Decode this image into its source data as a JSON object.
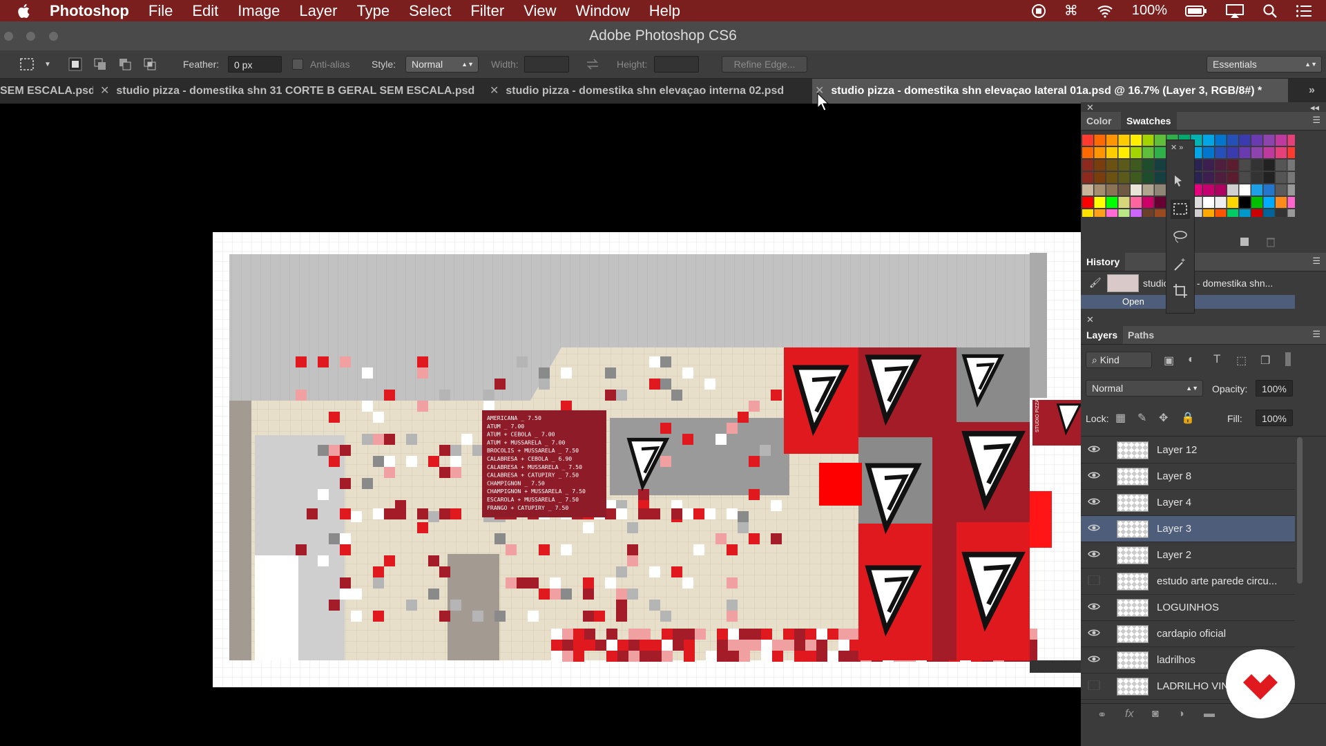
{
  "menubar": {
    "app_name": "Photoshop",
    "items": [
      "File",
      "Edit",
      "Image",
      "Layer",
      "Type",
      "Select",
      "Filter",
      "View",
      "Window",
      "Help"
    ],
    "battery": "100%"
  },
  "window": {
    "title": "Adobe Photoshop CS6"
  },
  "options": {
    "feather_label": "Feather:",
    "feather_value": "0 px",
    "antialias_label": "Anti-alias",
    "style_label": "Style:",
    "style_value": "Normal",
    "width_label": "Width:",
    "height_label": "Height:",
    "refine_edge": "Refine Edge...",
    "workspace": "Essentials"
  },
  "tabs": [
    {
      "label": "SEM ESCALA.psd"
    },
    {
      "label": "studio pizza - domestika shn 31 CORTE B GERAL SEM ESCALA.psd"
    },
    {
      "label": "studio pizza - domestika shn  elevaçao interna 02.psd"
    },
    {
      "label": "studio pizza - domestika shn  elevaçao lateral 01a.psd @ 16.7% (Layer 3, RGB/8#) *"
    }
  ],
  "menu_board": {
    "lines": [
      "AMERICANA _ 7.50",
      "ATUM _ 7.00",
      "ATUM + CEBOLA _ 7.00",
      "ATUM + MUSSARELA _ 7.00",
      "BROCOLIS + MUSSARELA _ 7.50",
      "CALABRESA + CEBOLA _ 6.90",
      "CALABRESA + MUSSARELA _ 7.50",
      "CALABRESA + CATUPIRY _ 7.50",
      "CHAMPIGNON _ 7.50",
      "CHAMPIGNON + MUSSARELA _ 7.50",
      "ESCAROLA + MUSSARELA _ 7.50",
      "FRANGO + CATUPIRY _ 7.50"
    ],
    "sign_text": "STUDIO PIZZA"
  },
  "panels": {
    "color_tab": "Color",
    "swatches_tab": "Swatches",
    "history_tab": "History",
    "history_item": "studio pizza - domestika shn...",
    "history_open": "Open",
    "layers_tab": "Layers",
    "paths_tab": "Paths",
    "kind_filter": "Kind",
    "blend_mode": "Normal",
    "opacity_label": "Opacity:",
    "opacity_value": "100%",
    "lock_label": "Lock:",
    "fill_label": "Fill:",
    "fill_value": "100%",
    "layers": [
      {
        "name": "Layer 12",
        "visible": true,
        "selected": false
      },
      {
        "name": "Layer 8",
        "visible": true,
        "selected": false
      },
      {
        "name": "Layer 4",
        "visible": true,
        "selected": false
      },
      {
        "name": "Layer 3",
        "visible": true,
        "selected": true
      },
      {
        "name": "Layer 2",
        "visible": true,
        "selected": false
      },
      {
        "name": "estudo arte parede circu...",
        "visible": false,
        "selected": false
      },
      {
        "name": "LOGUINHOS",
        "visible": true,
        "selected": false
      },
      {
        "name": "cardapio oficial",
        "visible": true,
        "selected": false
      },
      {
        "name": "ladrilhos",
        "visible": true,
        "selected": false
      },
      {
        "name": "LADRILHO VIN",
        "visible": false,
        "selected": false
      }
    ]
  },
  "colors": {
    "menubar": "#7a1e1e",
    "accent_red": "#e0191f",
    "selected_layer": "#4d5d7a"
  }
}
